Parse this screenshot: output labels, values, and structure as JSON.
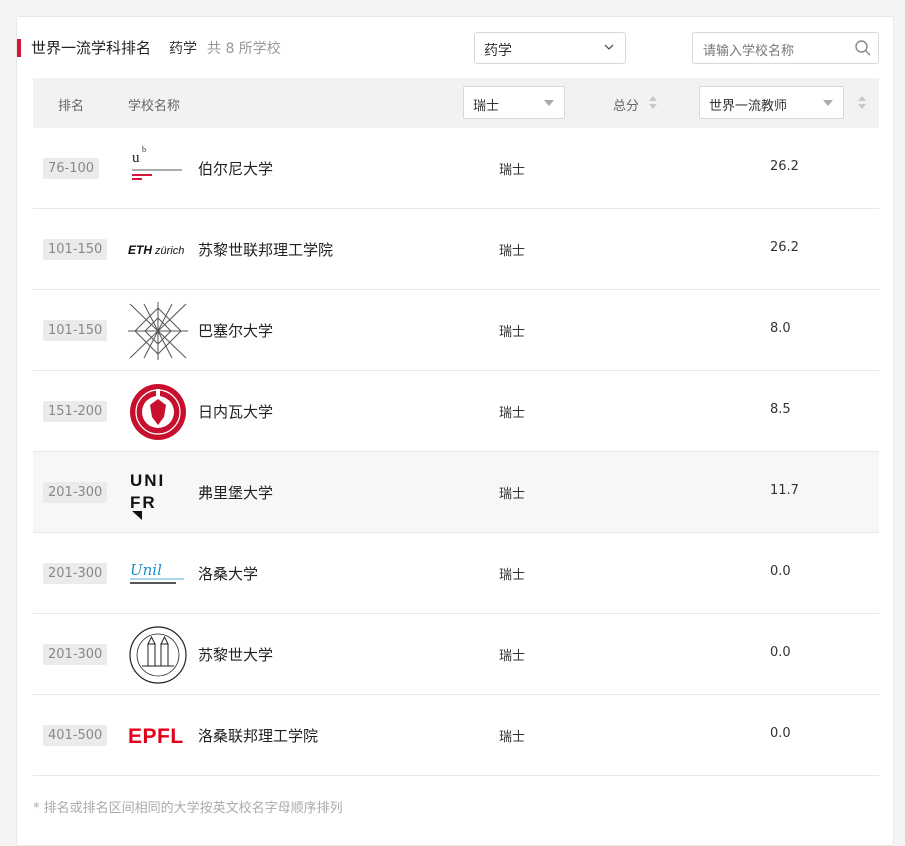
{
  "header": {
    "title": "世界一流学科排名",
    "subject": "药学",
    "count": "共 8 所学校",
    "subject_select": "药学",
    "search_placeholder": "请输入学校名称"
  },
  "table": {
    "col_rank": "排名",
    "col_name": "学校名称",
    "country_filter": "瑞士",
    "col_total": "总分",
    "indicator_select": "世界一流教师",
    "rows": [
      {
        "rank": "76-100",
        "name": "伯尔尼大学",
        "country": "瑞士",
        "score": "26.2",
        "logo": "bern-logo"
      },
      {
        "rank": "101-150",
        "name": "苏黎世联邦理工学院",
        "country": "瑞士",
        "score": "26.2",
        "logo": "eth-logo"
      },
      {
        "rank": "101-150",
        "name": "巴塞尔大学",
        "country": "瑞士",
        "score": "8.0",
        "logo": "basel-logo"
      },
      {
        "rank": "151-200",
        "name": "日内瓦大学",
        "country": "瑞士",
        "score": "8.5",
        "logo": "geneva-logo"
      },
      {
        "rank": "201-300",
        "name": "弗里堡大学",
        "country": "瑞士",
        "score": "11.7",
        "logo": "fribourg-logo"
      },
      {
        "rank": "201-300",
        "name": "洛桑大学",
        "country": "瑞士",
        "score": "0.0",
        "logo": "lausanne-logo"
      },
      {
        "rank": "201-300",
        "name": "苏黎世大学",
        "country": "瑞士",
        "score": "0.0",
        "logo": "zurich-logo"
      },
      {
        "rank": "401-500",
        "name": "洛桑联邦理工学院",
        "country": "瑞士",
        "score": "0.0",
        "logo": "epfl-logo"
      }
    ]
  },
  "logos": {
    "eth": "ETHzürich",
    "epfl": "EPFL",
    "unil": "Unil",
    "unifr": "UNIFR"
  },
  "footnote": "* 排名或排名区间相同的大学按英文校名字母顺序排列",
  "colors": {
    "accent": "#d6153a",
    "epfl_red": "#e3001a",
    "geneva_red": "#c8102e",
    "unil_blue": "#1a8fc9"
  }
}
